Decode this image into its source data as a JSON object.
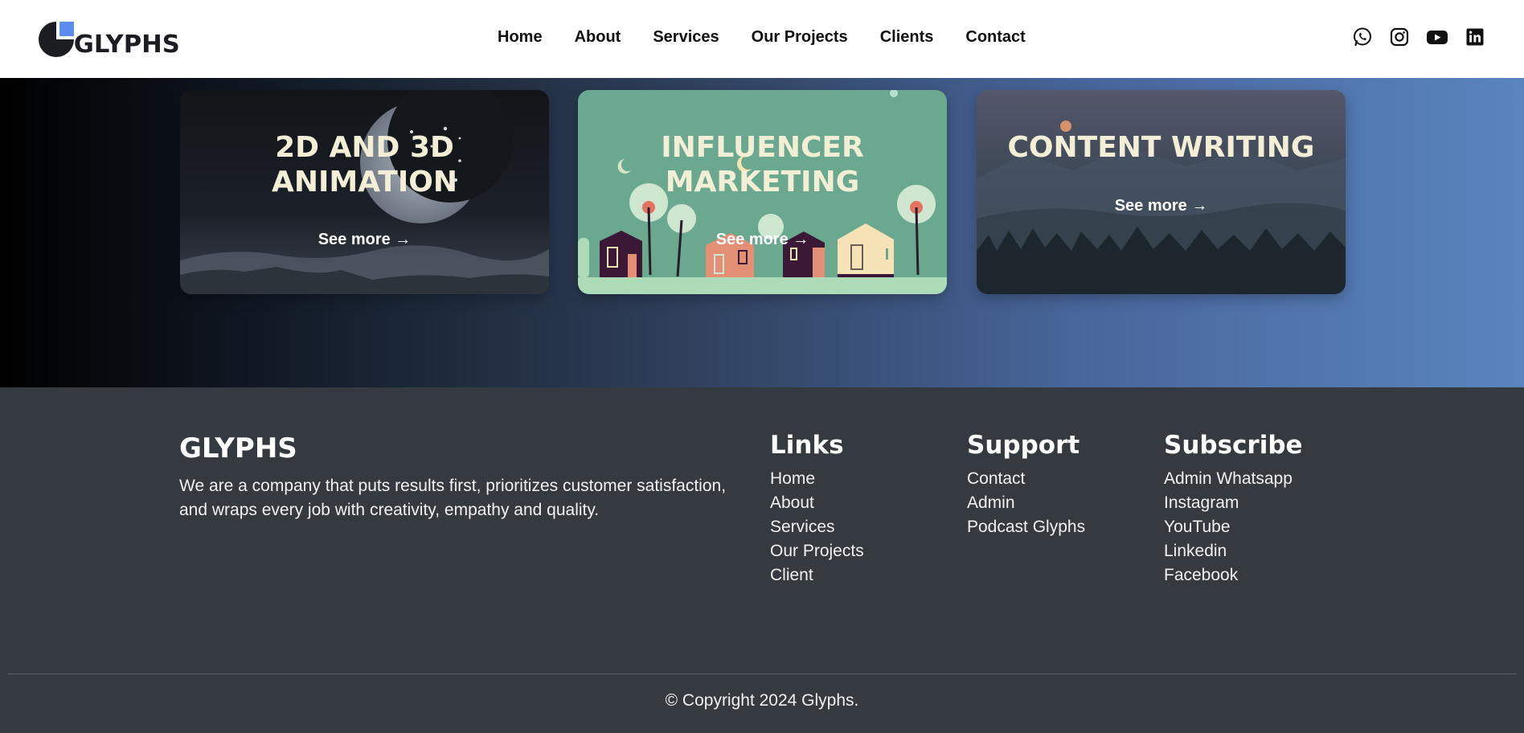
{
  "brand": {
    "name": "GLYPHS",
    "logo_icon": "glyphs-logo-mark"
  },
  "nav": {
    "items": [
      {
        "label": "Home"
      },
      {
        "label": "About"
      },
      {
        "label": "Services"
      },
      {
        "label": "Our Projects"
      },
      {
        "label": "Clients"
      },
      {
        "label": "Contact"
      }
    ]
  },
  "socials": {
    "icons": [
      "whatsapp-icon",
      "instagram-icon",
      "youtube-icon",
      "linkedin-icon"
    ]
  },
  "services": {
    "cards": [
      {
        "title_line1": "2D AND 3D",
        "title_line2": "ANIMATION",
        "link": "See more →",
        "image": "night-moon-landscape"
      },
      {
        "title_line1": "INFLUENCER",
        "title_line2": "MARKETING",
        "link": "See more →",
        "image": "village-houses-illustration"
      },
      {
        "title_line1": "CONTENT WRITING",
        "title_line2": "",
        "link": "See more →",
        "image": "misty-mountain-forest"
      }
    ]
  },
  "footer": {
    "brand": "GLYPHS",
    "about": "We are a company that puts results first, prioritizes customer satisfaction, and wraps every job with creativity, empathy and quality.",
    "columns": [
      {
        "heading": "Links",
        "items": [
          "Home",
          "About",
          "Services",
          "Our Projects",
          "Client"
        ]
      },
      {
        "heading": "Support",
        "items": [
          "Contact",
          "Admin",
          "Podcast Glyphs"
        ]
      },
      {
        "heading": "Subscribe",
        "items": [
          "Admin Whatsapp",
          "Instagram",
          "YouTube",
          "Linkedin",
          "Facebook"
        ]
      }
    ],
    "copyright": "© Copyright 2024 Glyphs."
  },
  "colors": {
    "header_bg": "#ffffff",
    "footer_bg": "#353940",
    "card_title": "#f3efd6",
    "logo_accent": "#5b8def"
  }
}
